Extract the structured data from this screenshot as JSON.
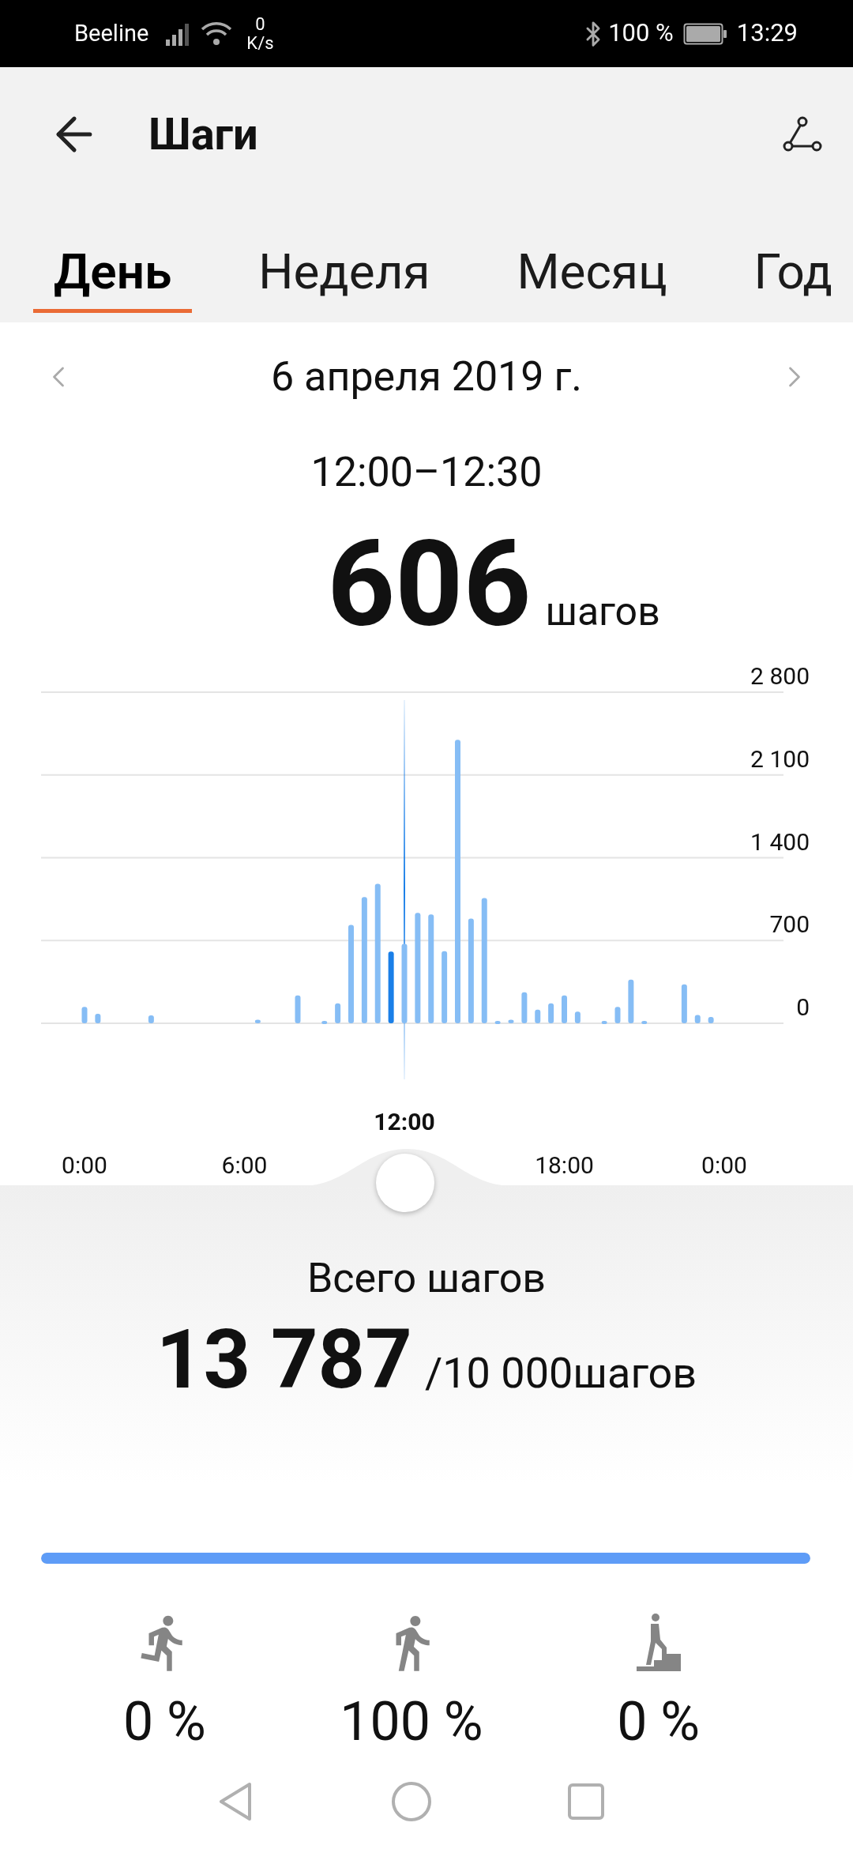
{
  "status_bar": {
    "carrier": "Beeline",
    "speed_value": "0",
    "speed_unit": "K/s",
    "battery": "100 %",
    "time": "13:29"
  },
  "header": {
    "title": "Шаги"
  },
  "tabs": [
    {
      "label": "День",
      "selected": true
    },
    {
      "label": "Неделя",
      "selected": false
    },
    {
      "label": "Месяц",
      "selected": false
    },
    {
      "label": "Год",
      "selected": false
    }
  ],
  "date_nav": {
    "date": "6 апреля 2019 г."
  },
  "selection": {
    "range": "12:00–12:30",
    "value": "606",
    "unit": "шагов",
    "handle_label": "12:00"
  },
  "chart_data": {
    "type": "bar",
    "stacked": true,
    "grid": true,
    "xlim": [
      0,
      24
    ],
    "ref_lines": [
      {
        "axis": "x",
        "value": 12
      }
    ],
    "x": [
      0,
      0.5,
      1,
      1.5,
      2,
      2.5,
      3,
      3.5,
      4,
      4.5,
      5,
      5.5,
      6,
      6.5,
      7,
      7.5,
      8,
      8.5,
      9,
      9.5,
      10,
      10.5,
      11,
      11.5,
      12,
      12.5,
      13,
      13.5,
      14,
      14.5,
      15,
      15.5,
      16,
      16.5,
      17,
      17.5,
      18,
      18.5,
      19,
      19.5,
      20,
      20.5,
      21,
      21.5,
      22,
      22.5,
      23,
      23.5
    ],
    "series": [
      {
        "color": "#86bdf5",
        "values": [
          138,
          80,
          null,
          null,
          null,
          67,
          null,
          null,
          null,
          null,
          null,
          null,
          null,
          30,
          null,
          null,
          236,
          null,
          20,
          169,
          832,
          1068,
          1179,
          null,
          672,
          934,
          921,
          610,
          2398,
          885,
          1059,
          20,
          30,
          262,
          116,
          169,
          236,
          98,
          null,
          20,
          138,
          369,
          20,
          null,
          null,
          329,
          71,
          53
        ]
      },
      {
        "color": "#1a7fe8",
        "values": [
          null,
          null,
          null,
          null,
          null,
          null,
          null,
          null,
          null,
          null,
          null,
          null,
          null,
          null,
          null,
          null,
          null,
          null,
          null,
          null,
          null,
          null,
          null,
          606,
          null,
          null,
          null,
          null,
          null,
          null,
          null,
          null,
          null,
          null,
          null,
          null,
          null,
          null,
          null,
          null,
          null,
          null,
          null,
          null,
          null,
          null,
          null,
          null
        ]
      }
    ],
    "ylim": [
      0,
      2800
    ],
    "yticks": [
      {
        "value": 0,
        "label": "0"
      },
      {
        "value": 700,
        "label": "700"
      },
      {
        "value": 1400,
        "label": "1 400"
      },
      {
        "value": 2100,
        "label": "2 100"
      },
      {
        "value": 2800,
        "label": "2 800"
      }
    ],
    "xticks": [
      {
        "value": 0,
        "label": "0:00"
      },
      {
        "value": 6,
        "label": "6:00"
      },
      {
        "value": 18,
        "label": "18:00"
      },
      {
        "value": 24,
        "label": "0:00"
      }
    ]
  },
  "total": {
    "title": "Всего шагов",
    "value": "13 787",
    "goal": "/10 000шагов",
    "level": 1
  },
  "activities": [
    {
      "kind": "run",
      "percent": "0 %"
    },
    {
      "kind": "walk",
      "percent": "100 %"
    },
    {
      "kind": "climb",
      "percent": "0 %"
    }
  ]
}
